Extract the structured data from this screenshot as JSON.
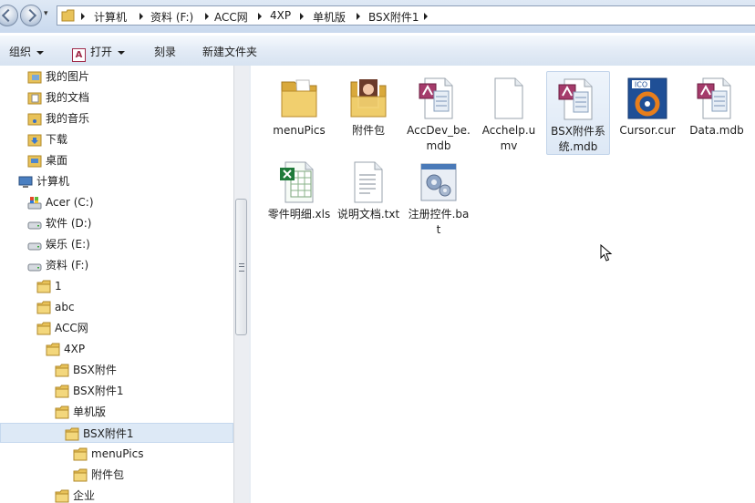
{
  "address": {
    "crumbs": [
      "计算机",
      "资料 (F:)",
      "ACC网",
      "4XP",
      "单机版",
      "BSX附件1"
    ]
  },
  "toolbar": {
    "organize_label": "组织",
    "open_label": "打开",
    "burn_label": "刻录",
    "new_folder_label": "新建文件夹"
  },
  "nav": {
    "items": [
      {
        "label": "我的图片",
        "icon": "pictures-folder-icon"
      },
      {
        "label": "我的文档",
        "icon": "documents-folder-icon"
      },
      {
        "label": "我的音乐",
        "icon": "music-folder-icon"
      },
      {
        "label": "下载",
        "icon": "downloads-folder-icon"
      },
      {
        "label": "桌面",
        "icon": "desktop-folder-icon"
      },
      {
        "label": "计算机",
        "icon": "computer-icon"
      },
      {
        "label": "Acer (C:)",
        "icon": "system-drive-icon"
      },
      {
        "label": "软件 (D:)",
        "icon": "drive-icon"
      },
      {
        "label": "娱乐 (E:)",
        "icon": "drive-icon"
      },
      {
        "label": "资料 (F:)",
        "icon": "drive-icon"
      },
      {
        "label": "1",
        "icon": "folder-icon"
      },
      {
        "label": "abc",
        "icon": "folder-icon"
      },
      {
        "label": "ACC网",
        "icon": "folder-icon"
      },
      {
        "label": "4XP",
        "icon": "folder-icon"
      },
      {
        "label": "BSX附件",
        "icon": "folder-icon"
      },
      {
        "label": "BSX附件1",
        "icon": "folder-icon"
      },
      {
        "label": "单机版",
        "icon": "folder-icon"
      },
      {
        "label": "BSX附件1",
        "icon": "folder-icon",
        "selected": true
      },
      {
        "label": "menuPics",
        "icon": "folder-icon"
      },
      {
        "label": "附件包",
        "icon": "folder-icon"
      },
      {
        "label": "企业",
        "icon": "folder-icon"
      }
    ]
  },
  "files": [
    {
      "label": "menuPics",
      "icon": "folder-icon"
    },
    {
      "label": "附件包",
      "icon": "photo-folder-icon"
    },
    {
      "label": "AccDev_be.mdb",
      "icon": "access-db-icon"
    },
    {
      "label": "Acchelp.umv",
      "icon": "generic-file-icon"
    },
    {
      "label": "BSX附件系统.mdb",
      "icon": "access-db-icon",
      "selected": true
    },
    {
      "label": "Cursor.cur",
      "icon": "cursor-file-icon",
      "badge": "ICO"
    },
    {
      "label": "Data.mdb",
      "icon": "access-db-icon"
    },
    {
      "label": "零件明细.xls",
      "icon": "excel-file-icon"
    },
    {
      "label": "说明文档.txt",
      "icon": "text-file-icon"
    },
    {
      "label": "注册控件.bat",
      "icon": "batch-file-icon"
    }
  ],
  "colors": {
    "folder": "#e8c259",
    "selection": "#dde9f6",
    "access": "#a53b6b",
    "excel": "#1f7a3a"
  }
}
